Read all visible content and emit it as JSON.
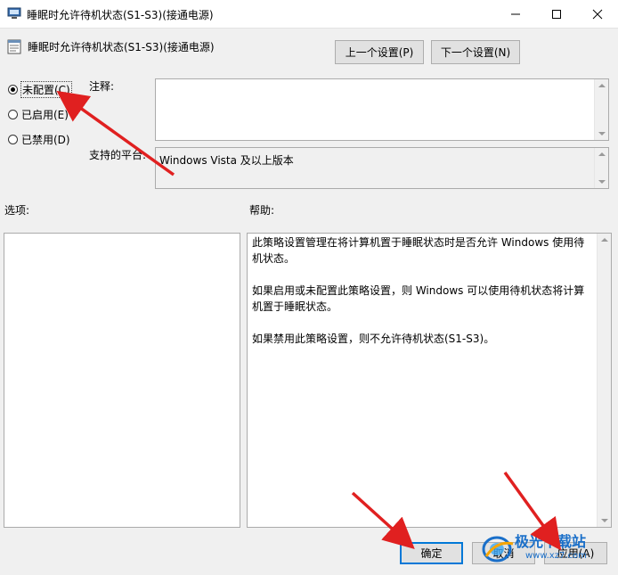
{
  "window": {
    "title": "睡眠时允许待机状态(S1-S3)(接通电源)",
    "minimize_icon": "minimize-icon",
    "maximize_icon": "maximize-icon",
    "close_icon": "close-icon"
  },
  "policy": {
    "title": "睡眠时允许待机状态(S1-S3)(接通电源)",
    "prev_label": "上一个设置(P)",
    "next_label": "下一个设置(N)"
  },
  "state": {
    "options": [
      {
        "label": "未配置(C)",
        "checked": true
      },
      {
        "label": "已启用(E)",
        "checked": false
      },
      {
        "label": "已禁用(D)",
        "checked": false
      }
    ]
  },
  "comment": {
    "label": "注释:",
    "value": ""
  },
  "platform": {
    "label": "支持的平台:",
    "value": "Windows Vista 及以上版本"
  },
  "options_label": "选项:",
  "help": {
    "label": "帮助:",
    "paragraphs": [
      "此策略设置管理在将计算机置于睡眠状态时是否允许 Windows 使用待机状态。",
      "如果启用或未配置此策略设置，则 Windows 可以使用待机状态将计算机置于睡眠状态。",
      "如果禁用此策略设置，则不允许待机状态(S1-S3)。"
    ]
  },
  "footer": {
    "ok_label": "确定",
    "cancel_label": "取消",
    "apply_label": "应用(A)"
  },
  "watermark": {
    "text": "极光下载站",
    "url": "www.xz7.com"
  },
  "colors": {
    "accent": "#0078d7",
    "annotation_arrow": "#e02020",
    "watermark": "#1a6fc9"
  }
}
